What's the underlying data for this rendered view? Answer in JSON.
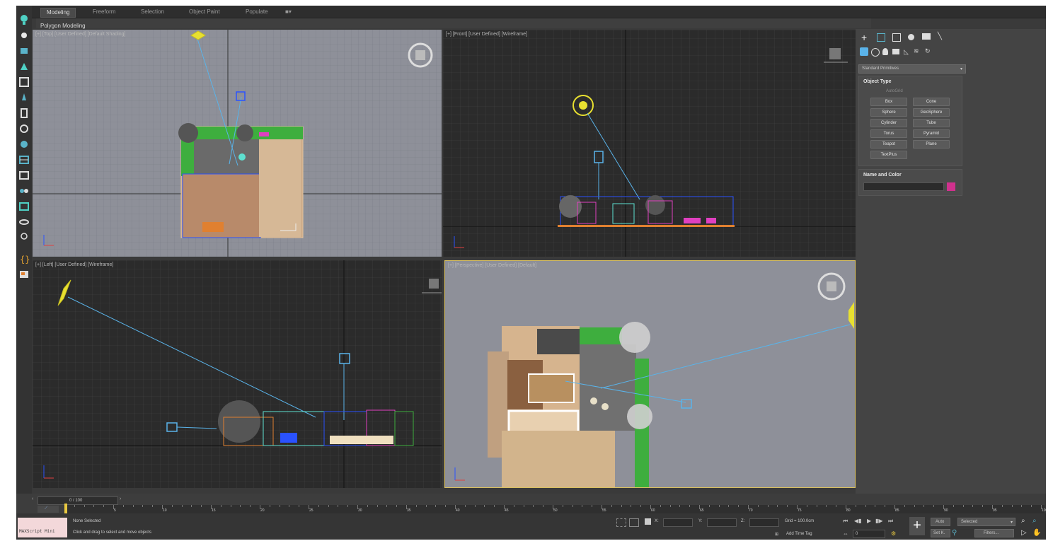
{
  "ribbon": {
    "tabs": [
      "Modeling",
      "Freeform",
      "Selection",
      "Object Paint",
      "Populate"
    ],
    "active_tab": "Modeling",
    "sub_label": "Polygon Modeling"
  },
  "viewports": {
    "top": {
      "label": "[+] [Top] [User Defined] [Default Shading]"
    },
    "front": {
      "label": "[+] [Front] [User Defined] [Wireframe]"
    },
    "left": {
      "label": "[+] [Left] [User Defined] [Wireframe]"
    },
    "camera": {
      "label": "[+] [Perspective] [User Defined] [Default]"
    }
  },
  "command_panel": {
    "dropdown": "Standard Primitives",
    "object_type_title": "Object Type",
    "autogrid": "AutoGrid",
    "buttons": [
      "Box",
      "Cone",
      "Sphere",
      "GeoSphere",
      "Cylinder",
      "Tube",
      "Torus",
      "Pyramid",
      "Teapot",
      "Plane",
      "TextPlus"
    ],
    "name_color_title": "Name and Color",
    "object_color": "#d0318e"
  },
  "timeline": {
    "frame_counter": "0 / 100",
    "ticks": [
      "0",
      "5",
      "10",
      "15",
      "20",
      "25",
      "30",
      "35",
      "40",
      "45",
      "50",
      "55",
      "60",
      "65",
      "70",
      "75",
      "80",
      "85",
      "90",
      "95",
      "100"
    ]
  },
  "status": {
    "maxscript": "MAXScript Mini",
    "selection_status": "None Selected",
    "prompt": "Click and drag to select and move objects",
    "x_label": "X:",
    "y_label": "Y:",
    "z_label": "Z:",
    "grid": "Grid = 100.0cm",
    "add_time_tag": "Add Time Tag",
    "auto_key": "Auto",
    "set_key": "Set K.",
    "key_filter": "Selected",
    "filters": "Filters...",
    "current_frame": "0"
  },
  "colors": {
    "accent": "#d0318e",
    "viewport_dark": "#2b2b2b",
    "viewport_light": "#8e9099"
  }
}
